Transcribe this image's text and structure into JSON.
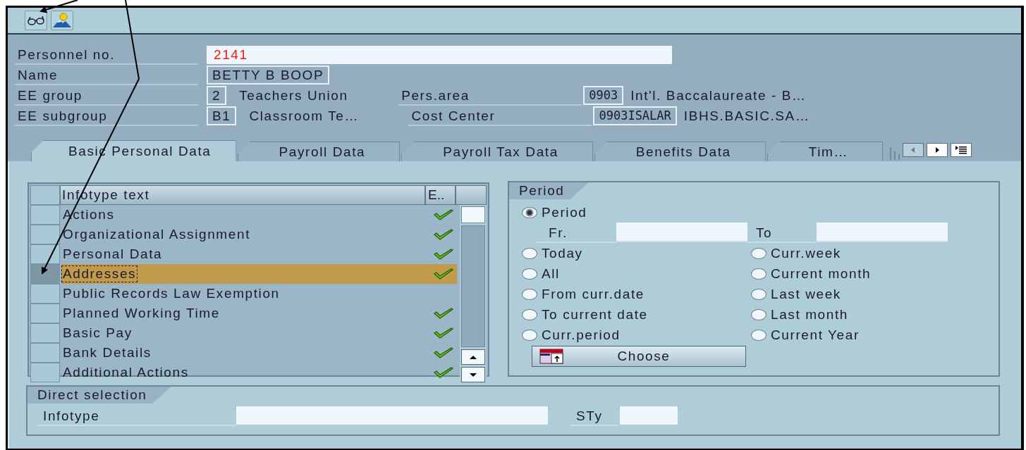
{
  "header": {
    "rows": [
      {
        "label": "Personnel no.",
        "value": "2141",
        "kind": "input"
      },
      {
        "label": "Name",
        "value": "BETTY  B  BOOP",
        "kind": "display"
      },
      {
        "label": "EE group",
        "value": "2",
        "kind": "display",
        "text": "Teachers Union",
        "label_2": "Pers.area",
        "value_2": "0903",
        "text_2": "Int'l. Baccalaureate - B…"
      },
      {
        "label": "EE subgroup",
        "value": "B1",
        "kind": "display",
        "text": "Classroom Te…",
        "label_2": "Cost Center",
        "value_2": "0903ISALAR",
        "text_2": "IBHS.BASIC.SA…"
      }
    ]
  },
  "tabs": [
    {
      "label": "Basic Personal Data",
      "selected": true
    },
    {
      "label": "Payroll Data",
      "selected": false
    },
    {
      "label": "Payroll Tax Data",
      "selected": false
    },
    {
      "label": "Benefits Data",
      "selected": false
    },
    {
      "label": "Tim…",
      "selected": false
    }
  ],
  "table": {
    "columns": [
      "Infotype text",
      "E.."
    ],
    "rows": [
      {
        "text": "Actions",
        "checked": true,
        "selected": false
      },
      {
        "text": "Organizational Assignment",
        "checked": true,
        "selected": false
      },
      {
        "text": "Personal Data",
        "checked": true,
        "selected": false
      },
      {
        "text": "Addresses",
        "checked": true,
        "selected": true
      },
      {
        "text": "Public Records Law Exemption",
        "checked": false,
        "selected": false
      },
      {
        "text": "Planned Working Time",
        "checked": true,
        "selected": false
      },
      {
        "text": "Basic Pay",
        "checked": true,
        "selected": false
      },
      {
        "text": "Bank Details",
        "checked": true,
        "selected": false
      },
      {
        "text": "Additional Actions",
        "checked": true,
        "selected": false
      }
    ]
  },
  "period": {
    "title": "Period",
    "options": [
      {
        "label": "Period",
        "selected": true
      },
      {
        "label": "Today",
        "selected": false
      },
      {
        "label": "All",
        "selected": false
      },
      {
        "label": "From curr.date",
        "selected": false
      },
      {
        "label": "To current date",
        "selected": false
      },
      {
        "label": "Curr.period",
        "selected": false
      },
      {
        "label": "Curr.week",
        "selected": false
      },
      {
        "label": "Current month",
        "selected": false
      },
      {
        "label": "Last week",
        "selected": false
      },
      {
        "label": "Last month",
        "selected": false
      },
      {
        "label": "Current Year",
        "selected": false
      }
    ],
    "from_label": "Fr.",
    "to_label": "To",
    "button": "Choose"
  },
  "direct_selection": {
    "title": "Direct selection",
    "infotype_label": "Infotype",
    "subtype_label": "STy"
  }
}
